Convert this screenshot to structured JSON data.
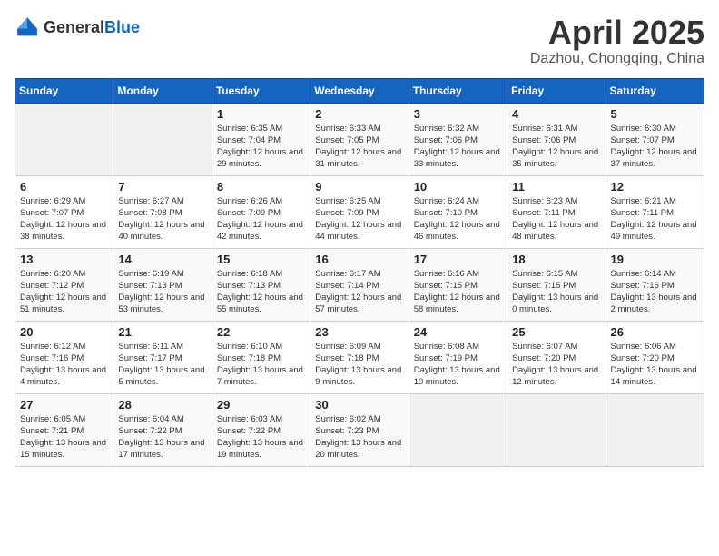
{
  "header": {
    "logo_general": "General",
    "logo_blue": "Blue",
    "title": "April 2025",
    "subtitle": "Dazhou, Chongqing, China"
  },
  "calendar": {
    "days_of_week": [
      "Sunday",
      "Monday",
      "Tuesday",
      "Wednesday",
      "Thursday",
      "Friday",
      "Saturday"
    ],
    "weeks": [
      [
        {
          "day": "",
          "info": ""
        },
        {
          "day": "",
          "info": ""
        },
        {
          "day": "1",
          "info": "Sunrise: 6:35 AM\nSunset: 7:04 PM\nDaylight: 12 hours and 29 minutes."
        },
        {
          "day": "2",
          "info": "Sunrise: 6:33 AM\nSunset: 7:05 PM\nDaylight: 12 hours and 31 minutes."
        },
        {
          "day": "3",
          "info": "Sunrise: 6:32 AM\nSunset: 7:06 PM\nDaylight: 12 hours and 33 minutes."
        },
        {
          "day": "4",
          "info": "Sunrise: 6:31 AM\nSunset: 7:06 PM\nDaylight: 12 hours and 35 minutes."
        },
        {
          "day": "5",
          "info": "Sunrise: 6:30 AM\nSunset: 7:07 PM\nDaylight: 12 hours and 37 minutes."
        }
      ],
      [
        {
          "day": "6",
          "info": "Sunrise: 6:29 AM\nSunset: 7:07 PM\nDaylight: 12 hours and 38 minutes."
        },
        {
          "day": "7",
          "info": "Sunrise: 6:27 AM\nSunset: 7:08 PM\nDaylight: 12 hours and 40 minutes."
        },
        {
          "day": "8",
          "info": "Sunrise: 6:26 AM\nSunset: 7:09 PM\nDaylight: 12 hours and 42 minutes."
        },
        {
          "day": "9",
          "info": "Sunrise: 6:25 AM\nSunset: 7:09 PM\nDaylight: 12 hours and 44 minutes."
        },
        {
          "day": "10",
          "info": "Sunrise: 6:24 AM\nSunset: 7:10 PM\nDaylight: 12 hours and 46 minutes."
        },
        {
          "day": "11",
          "info": "Sunrise: 6:23 AM\nSunset: 7:11 PM\nDaylight: 12 hours and 48 minutes."
        },
        {
          "day": "12",
          "info": "Sunrise: 6:21 AM\nSunset: 7:11 PM\nDaylight: 12 hours and 49 minutes."
        }
      ],
      [
        {
          "day": "13",
          "info": "Sunrise: 6:20 AM\nSunset: 7:12 PM\nDaylight: 12 hours and 51 minutes."
        },
        {
          "day": "14",
          "info": "Sunrise: 6:19 AM\nSunset: 7:13 PM\nDaylight: 12 hours and 53 minutes."
        },
        {
          "day": "15",
          "info": "Sunrise: 6:18 AM\nSunset: 7:13 PM\nDaylight: 12 hours and 55 minutes."
        },
        {
          "day": "16",
          "info": "Sunrise: 6:17 AM\nSunset: 7:14 PM\nDaylight: 12 hours and 57 minutes."
        },
        {
          "day": "17",
          "info": "Sunrise: 6:16 AM\nSunset: 7:15 PM\nDaylight: 12 hours and 58 minutes."
        },
        {
          "day": "18",
          "info": "Sunrise: 6:15 AM\nSunset: 7:15 PM\nDaylight: 13 hours and 0 minutes."
        },
        {
          "day": "19",
          "info": "Sunrise: 6:14 AM\nSunset: 7:16 PM\nDaylight: 13 hours and 2 minutes."
        }
      ],
      [
        {
          "day": "20",
          "info": "Sunrise: 6:12 AM\nSunset: 7:16 PM\nDaylight: 13 hours and 4 minutes."
        },
        {
          "day": "21",
          "info": "Sunrise: 6:11 AM\nSunset: 7:17 PM\nDaylight: 13 hours and 5 minutes."
        },
        {
          "day": "22",
          "info": "Sunrise: 6:10 AM\nSunset: 7:18 PM\nDaylight: 13 hours and 7 minutes."
        },
        {
          "day": "23",
          "info": "Sunrise: 6:09 AM\nSunset: 7:18 PM\nDaylight: 13 hours and 9 minutes."
        },
        {
          "day": "24",
          "info": "Sunrise: 6:08 AM\nSunset: 7:19 PM\nDaylight: 13 hours and 10 minutes."
        },
        {
          "day": "25",
          "info": "Sunrise: 6:07 AM\nSunset: 7:20 PM\nDaylight: 13 hours and 12 minutes."
        },
        {
          "day": "26",
          "info": "Sunrise: 6:06 AM\nSunset: 7:20 PM\nDaylight: 13 hours and 14 minutes."
        }
      ],
      [
        {
          "day": "27",
          "info": "Sunrise: 6:05 AM\nSunset: 7:21 PM\nDaylight: 13 hours and 15 minutes."
        },
        {
          "day": "28",
          "info": "Sunrise: 6:04 AM\nSunset: 7:22 PM\nDaylight: 13 hours and 17 minutes."
        },
        {
          "day": "29",
          "info": "Sunrise: 6:03 AM\nSunset: 7:22 PM\nDaylight: 13 hours and 19 minutes."
        },
        {
          "day": "30",
          "info": "Sunrise: 6:02 AM\nSunset: 7:23 PM\nDaylight: 13 hours and 20 minutes."
        },
        {
          "day": "",
          "info": ""
        },
        {
          "day": "",
          "info": ""
        },
        {
          "day": "",
          "info": ""
        }
      ]
    ]
  }
}
